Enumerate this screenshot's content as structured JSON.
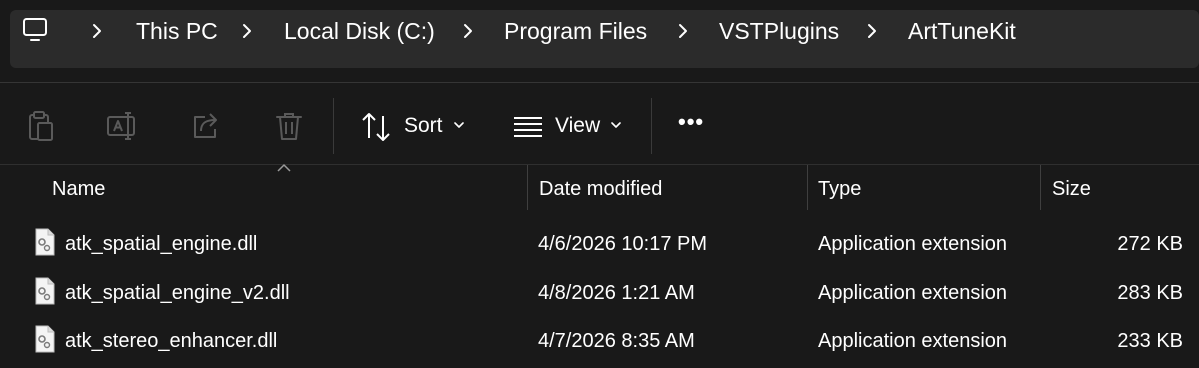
{
  "address_bar": {
    "root_icon": "this-pc-icon",
    "crumbs": [
      "This PC",
      "Local Disk (C:)",
      "Program Files",
      "VSTPlugins",
      "ArtTuneKit"
    ]
  },
  "toolbar": {
    "icons": [
      "paste-icon",
      "rename-icon",
      "share-icon",
      "delete-icon"
    ],
    "sort_label": "Sort",
    "view_label": "View",
    "more_label": "•••"
  },
  "columns": {
    "name": "Name",
    "date": "Date modified",
    "type": "Type",
    "size": "Size"
  },
  "files": [
    {
      "name": "atk_spatial_engine.dll",
      "date": "4/6/2026 10:17 PM",
      "type": "Application extension",
      "size": "272 KB"
    },
    {
      "name": "atk_spatial_engine_v2.dll",
      "date": "4/8/2026 1:21 AM",
      "type": "Application extension",
      "size": "283 KB"
    },
    {
      "name": "atk_stereo_enhancer.dll",
      "date": "4/7/2026 8:35 AM",
      "type": "Application extension",
      "size": "233 KB"
    }
  ],
  "colors": {
    "background": "#191919",
    "address_bar": "#2b2b2b",
    "disabled_icon": "#5a5a5a"
  }
}
